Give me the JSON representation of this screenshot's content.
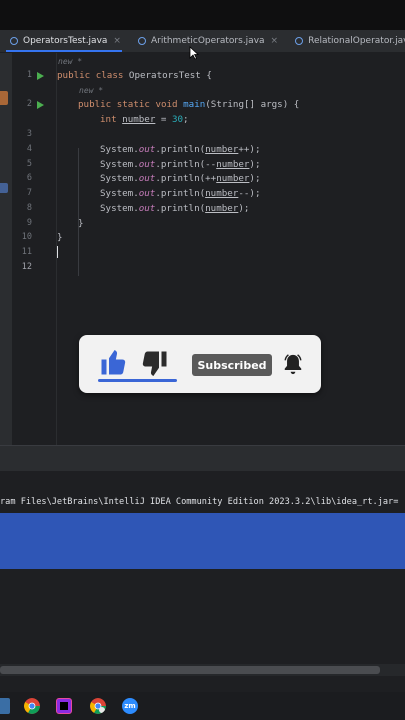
{
  "tabs": [
    {
      "label": "OperatorsTest.java",
      "active": true,
      "closable": true
    },
    {
      "label": "ArithmeticOperators.java",
      "active": false,
      "closable": true
    },
    {
      "label": "RelationalOperator.java",
      "active": false,
      "closable": false
    }
  ],
  "tab_close_glyph": "×",
  "editor": {
    "hint_label": "new *",
    "line_numbers": [
      "1",
      "2",
      "3",
      "4",
      "5",
      "6",
      "7",
      "8",
      "9",
      "10",
      "11",
      "12"
    ],
    "current_line": "12",
    "code": {
      "l1_kw": "public class",
      "l1_rest": " OperatorsTest {",
      "l2_kw": "public static void",
      "l2_fn": "main",
      "l2_rest": "(String[] args) {",
      "l3_kw": "int",
      "l3_var": "number",
      "l3_eq": " = ",
      "l3_num": "30",
      "l3_end": ";",
      "sys": "System.",
      "out": "out",
      "println": ".println(",
      "var": "number",
      "l5_post": "++);",
      "l6_pre": "--",
      "l7_pre": "++",
      "l8_post": "--);",
      "close_paren": ");",
      "close_brace": "}"
    }
  },
  "overlay": {
    "subscribed_label": "Subscribed",
    "icons": [
      "thumbs-up-icon",
      "thumbs-down-icon",
      "bell-icon"
    ]
  },
  "console": {
    "command_line": "ram Files\\JetBrains\\IntelliJ IDEA Community Edition 2023.3.2\\lib\\idea_rt.jar="
  },
  "taskbar": {
    "zoom_label": "zm"
  },
  "colors": {
    "accent": "#3574f0",
    "selection": "#2f56b6",
    "keyword": "#cf8e6d",
    "function": "#56a8f5",
    "number": "#2aacb8",
    "field": "#c77dbb"
  }
}
